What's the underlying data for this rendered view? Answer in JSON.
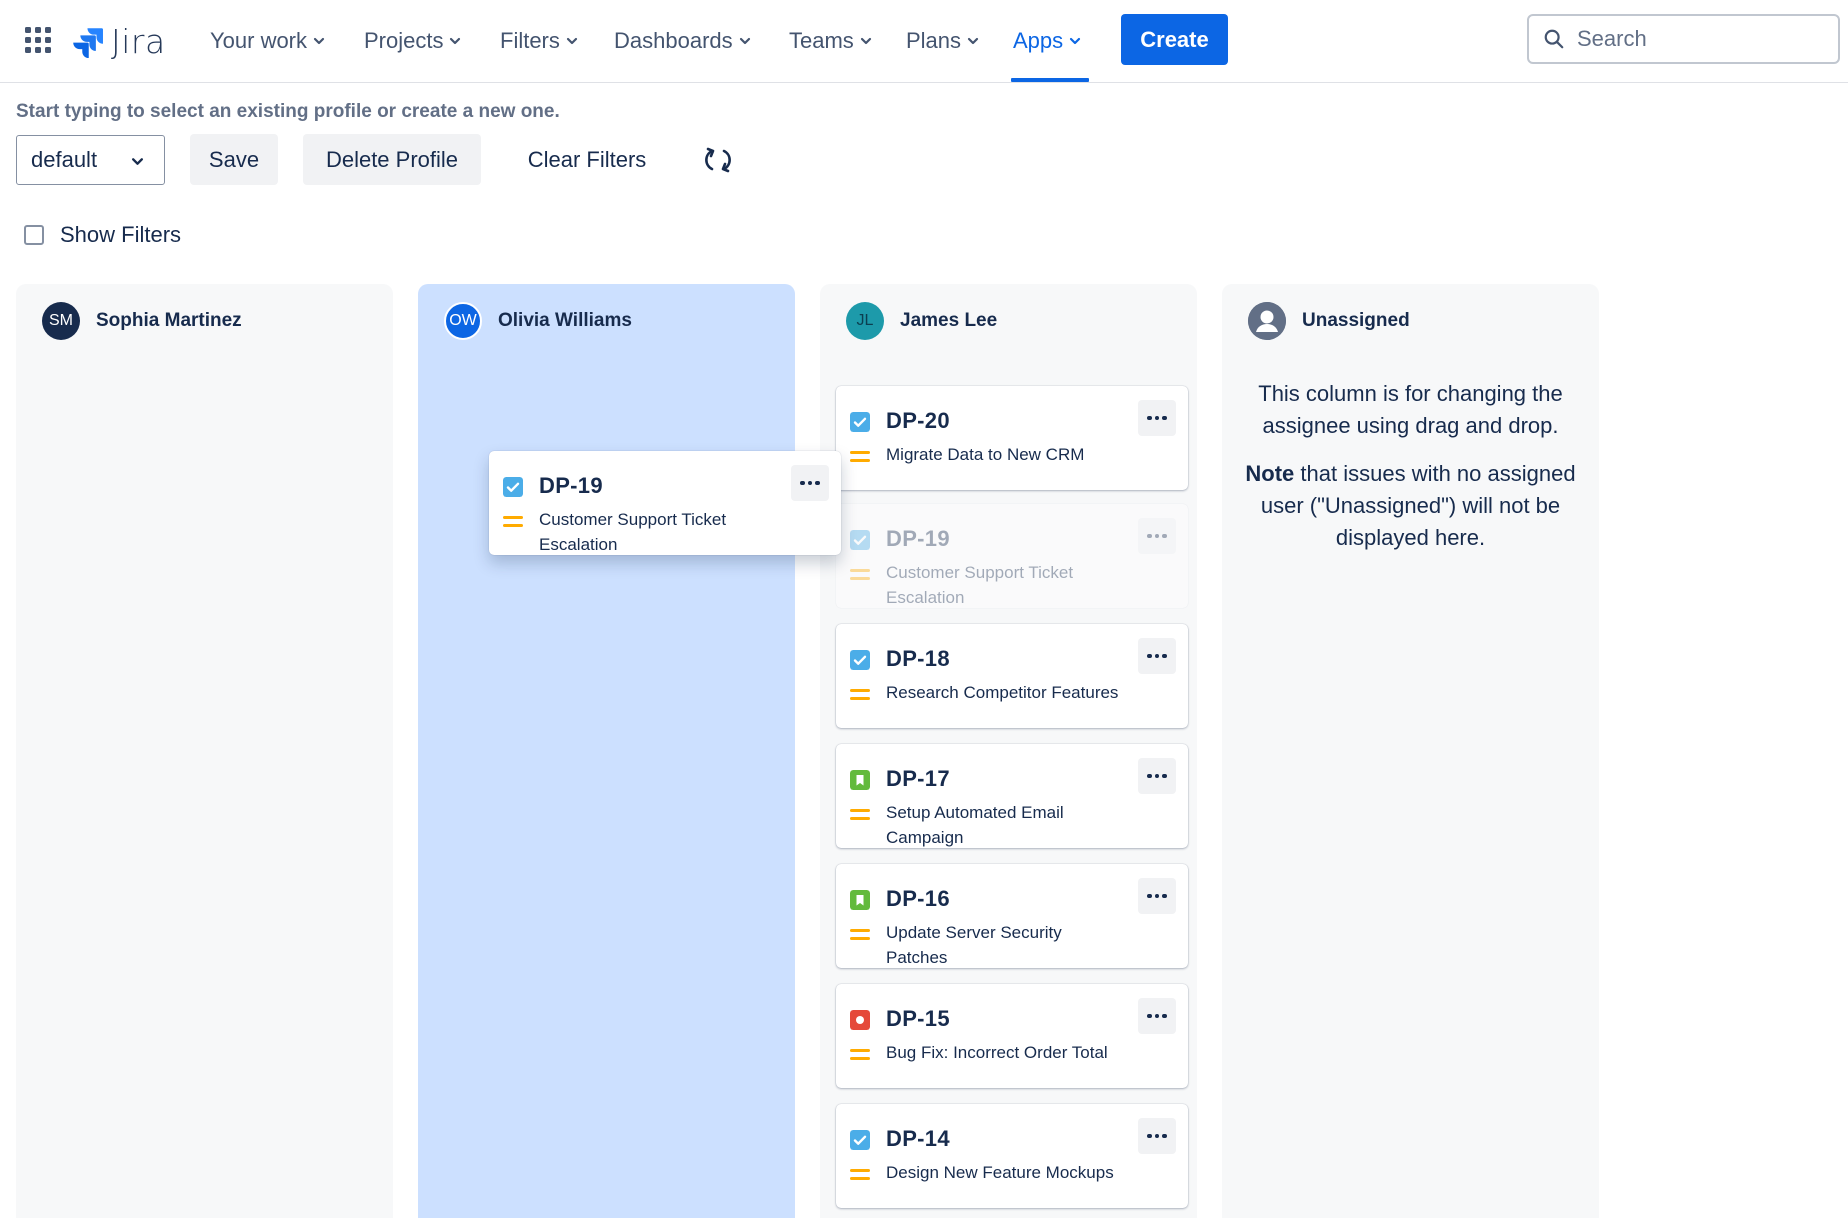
{
  "nav": {
    "logo_text": "Jira",
    "items": [
      {
        "label": "Your work"
      },
      {
        "label": "Projects"
      },
      {
        "label": "Filters"
      },
      {
        "label": "Dashboards"
      },
      {
        "label": "Teams"
      },
      {
        "label": "Plans"
      },
      {
        "label": "Apps",
        "active": true
      }
    ],
    "create_label": "Create",
    "search_placeholder": "Search"
  },
  "toolbar": {
    "hint": "Start typing to select an existing profile or create a new one.",
    "profile_value": "default",
    "save_label": "Save",
    "delete_label": "Delete Profile",
    "clear_label": "Clear Filters",
    "show_filters_label": "Show Filters",
    "show_filters_checked": false
  },
  "columns": [
    {
      "name": "Sophia Martinez",
      "initials": "SM",
      "avatar_color": "#172b4d"
    },
    {
      "name": "Olivia Williams",
      "initials": "OW",
      "avatar_color": "#0c66e4",
      "highlighted": true
    },
    {
      "name": "James Lee",
      "initials": "JL",
      "avatar_color": "#1d9aaa"
    },
    {
      "name": "Unassigned",
      "initials": "",
      "avatar_color": "#626f86"
    }
  ],
  "unassigned_note": {
    "line1": "This column is for changing the assignee using drag and drop.",
    "note_bold": "Note",
    "note_rest": " that issues with no assigned user (\"Unassigned\") will not be displayed here."
  },
  "dragging_card": {
    "key": "DP-19",
    "summary": "Customer Support Ticket Escalation",
    "type": "task",
    "priority": "medium"
  },
  "james_cards": [
    {
      "key": "DP-20",
      "summary": "Migrate Data to New CRM",
      "type": "task",
      "priority": "medium"
    },
    {
      "key": "DP-19",
      "summary": "Customer Support Ticket Escalation",
      "type": "task",
      "priority": "medium",
      "ghost": true
    },
    {
      "key": "DP-18",
      "summary": "Research Competitor Features",
      "type": "task",
      "priority": "medium"
    },
    {
      "key": "DP-17",
      "summary": "Setup Automated Email Campaign",
      "type": "story",
      "priority": "medium"
    },
    {
      "key": "DP-16",
      "summary": "Update Server Security Patches",
      "type": "story",
      "priority": "medium"
    },
    {
      "key": "DP-15",
      "summary": "Bug Fix: Incorrect Order Total",
      "type": "bug",
      "priority": "medium"
    },
    {
      "key": "DP-14",
      "summary": "Design New Feature Mockups",
      "type": "task",
      "priority": "medium"
    }
  ],
  "colors": {
    "brand": "#0c66e4",
    "task": "#4bade8",
    "story": "#63ba3c",
    "bug": "#e5493a",
    "priority_medium": "#ffab00"
  }
}
